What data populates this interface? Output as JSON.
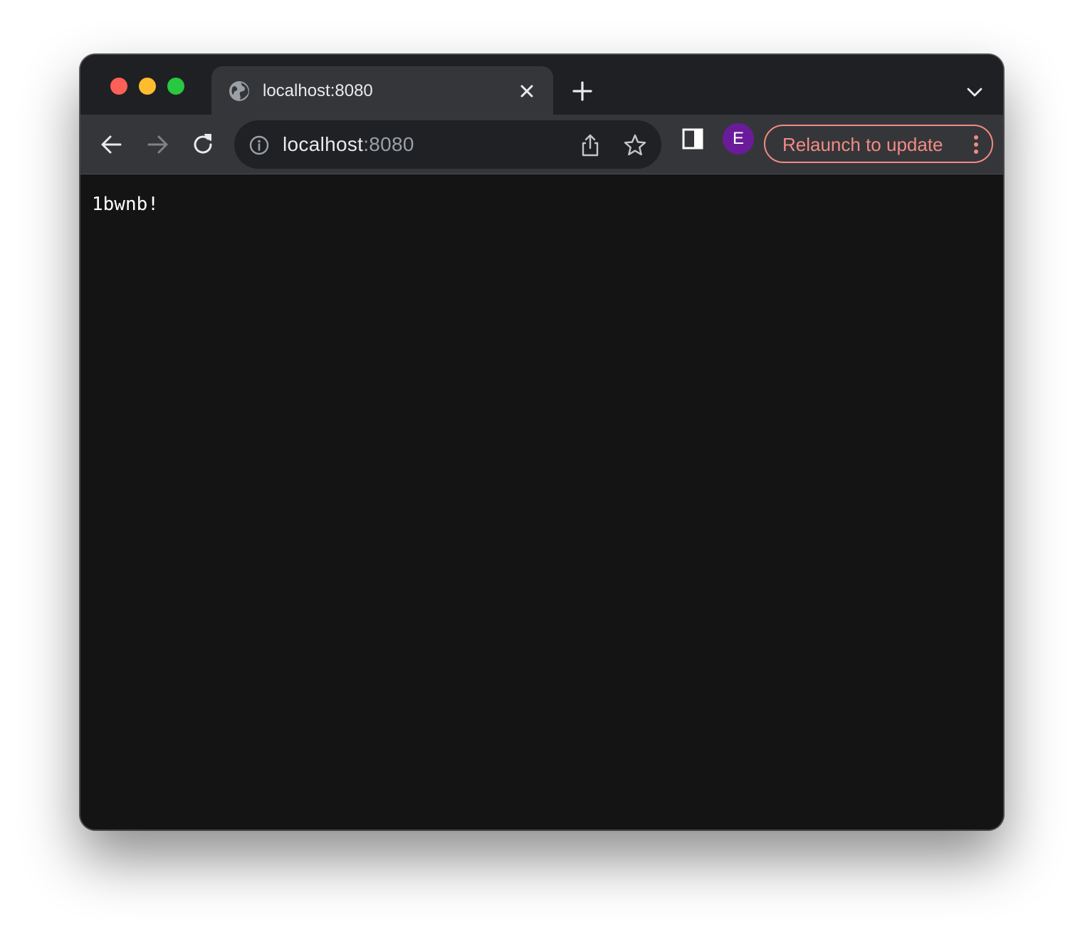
{
  "window": {
    "controls": [
      "close",
      "minimize",
      "maximize"
    ]
  },
  "tab": {
    "title": "localhost:8080",
    "favicon": "globe-icon",
    "close_icon": "close-icon"
  },
  "tabstrip": {
    "new_tab_icon": "plus-icon",
    "tab_search_icon": "chevron-down-icon"
  },
  "toolbar": {
    "back_icon": "arrow-left-icon",
    "forward_icon": "arrow-right-icon",
    "reload_icon": "reload-icon",
    "side_panel_icon": "side-panel-icon"
  },
  "omnibox": {
    "host": "localhost",
    "port": ":8080",
    "info_icon": "info-icon",
    "share_icon": "share-icon",
    "bookmark_icon": "star-icon"
  },
  "profile": {
    "initial": "E",
    "color": "#6a1b9a"
  },
  "relaunch": {
    "label": "Relaunch to update",
    "color": "#f28b82",
    "menu_icon": "more-vertical-icon"
  },
  "page": {
    "body_text": "1bwnb!"
  }
}
